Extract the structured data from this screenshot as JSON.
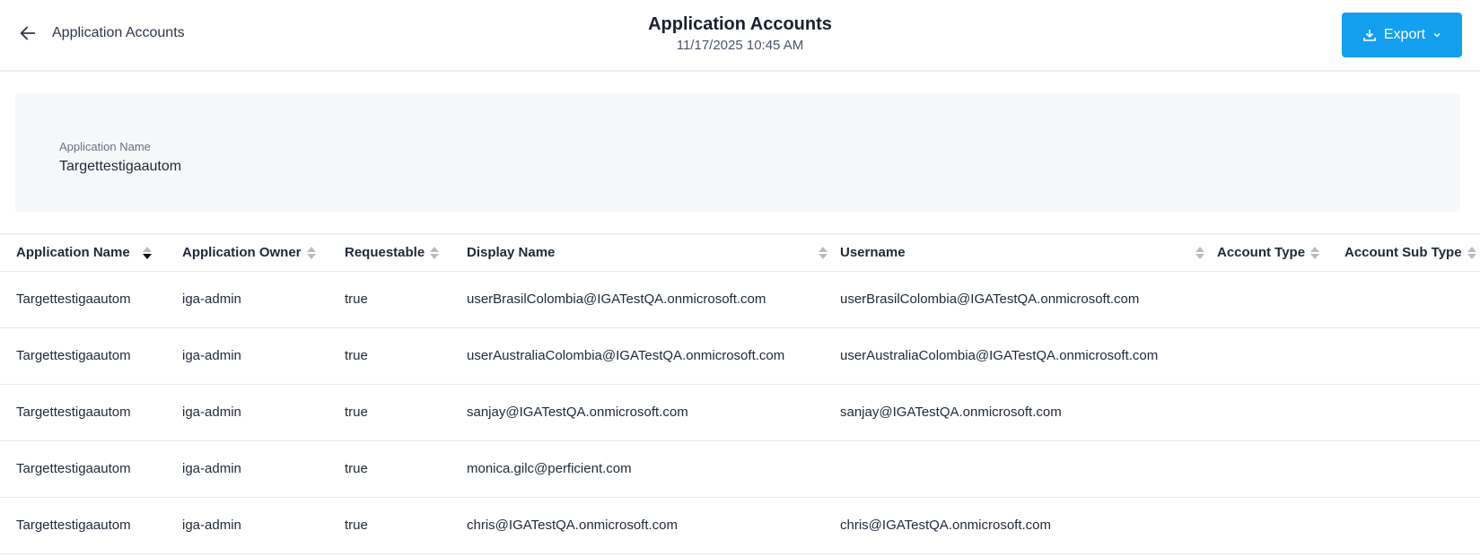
{
  "header": {
    "breadcrumb": "Application Accounts",
    "title": "Application Accounts",
    "timestamp": "11/17/2025 10:45 AM",
    "export_label": "Export",
    "accent": "#139ff0"
  },
  "summary": {
    "label": "Application Name",
    "value": "Targettestigaautom"
  },
  "table": {
    "columns": [
      "Application Name",
      "Application Owner",
      "Requestable",
      "Display Name",
      "Username",
      "Account Type",
      "Account Sub Type"
    ],
    "sorted_column": "Application Name",
    "sort_direction": "descending",
    "rows": [
      [
        "Targettestigaautom",
        "iga-admin",
        "true",
        "userBrasilColombia@IGATestQA.onmicrosoft.com",
        "userBrasilColombia@IGATestQA.onmicrosoft.com",
        "",
        ""
      ],
      [
        "Targettestigaautom",
        "iga-admin",
        "true",
        "userAustraliaColombia@IGATestQA.onmicrosoft.com",
        "userAustraliaColombia@IGATestQA.onmicrosoft.com",
        "",
        ""
      ],
      [
        "Targettestigaautom",
        "iga-admin",
        "true",
        "sanjay@IGATestQA.onmicrosoft.com",
        "sanjay@IGATestQA.onmicrosoft.com",
        "",
        ""
      ],
      [
        "Targettestigaautom",
        "iga-admin",
        "true",
        "monica.gilc@perficient.com",
        "",
        "",
        ""
      ],
      [
        "Targettestigaautom",
        "iga-admin",
        "true",
        "chris@IGATestQA.onmicrosoft.com",
        "chris@IGATestQA.onmicrosoft.com",
        "",
        ""
      ]
    ]
  }
}
